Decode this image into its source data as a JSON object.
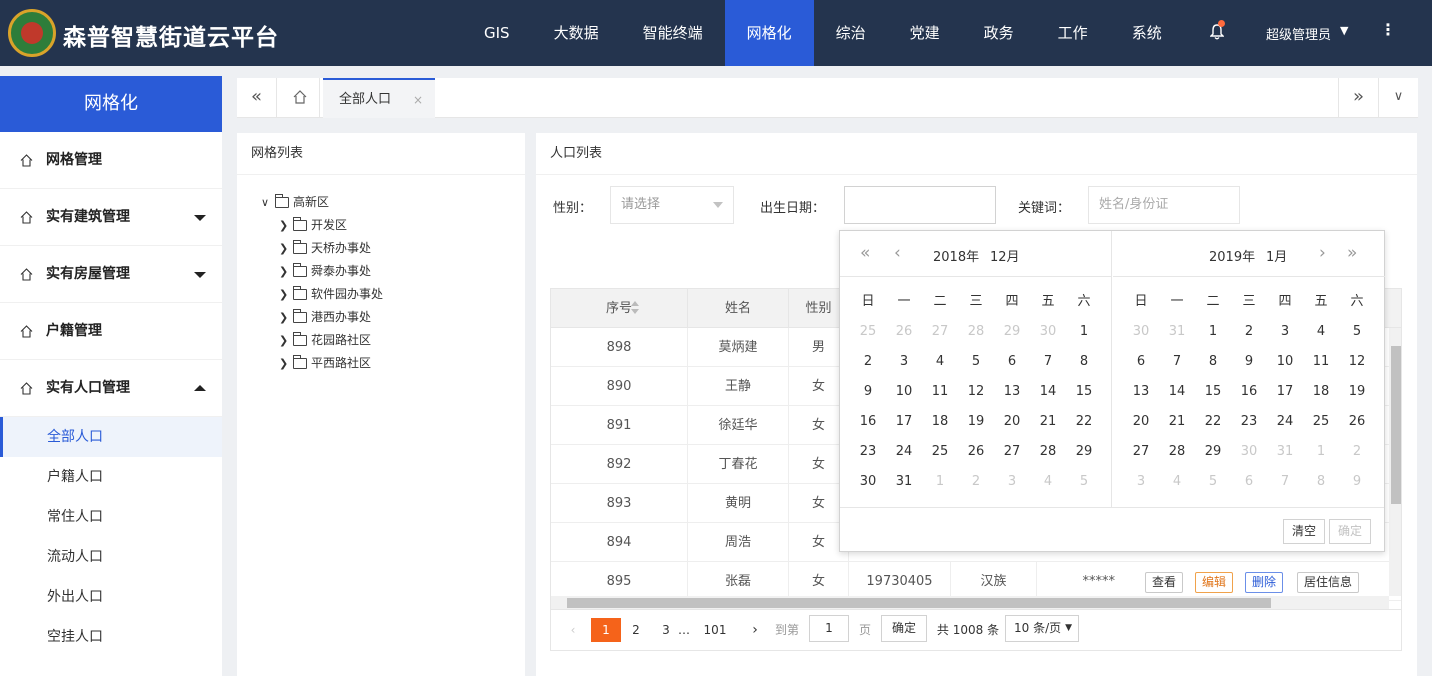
{
  "header": {
    "title": "森普智慧街道云平台",
    "nav": [
      "GIS",
      "大数据",
      "智能终端",
      "网格化",
      "综治",
      "党建",
      "政务",
      "工作",
      "系统"
    ],
    "active_nav": "网格化",
    "user": "超级管理员"
  },
  "sidebar": {
    "title": "网格化",
    "menus": [
      {
        "label": "网格管理"
      },
      {
        "label": "实有建筑管理"
      },
      {
        "label": "实有房屋管理"
      },
      {
        "label": "户籍管理"
      },
      {
        "label": "实有人口管理"
      }
    ],
    "subitems": [
      "全部人口",
      "户籍人口",
      "常住人口",
      "流动人口",
      "外出人口",
      "空挂人口"
    ]
  },
  "tabs": {
    "active": "全部人口",
    "close": "×"
  },
  "grid_panel": {
    "title": "网格列表",
    "root": "高新区",
    "children": [
      "开发区",
      "天桥办事处",
      "舜泰办事处",
      "软件园办事处",
      "港西办事处",
      "花园路社区",
      "平西路社区"
    ]
  },
  "main": {
    "title": "人口列表",
    "filters": {
      "gender_label": "性别：",
      "gender_placeholder": "请选择",
      "birth_label": "出生日期：",
      "keyword_label": "关键词：",
      "keyword_placeholder": "姓名/身份证"
    },
    "columns": [
      "序号",
      "姓名",
      "性别"
    ],
    "rows": [
      {
        "id": "898",
        "name": "莫炳建",
        "gender": "男"
      },
      {
        "id": "890",
        "name": "王静",
        "gender": "女"
      },
      {
        "id": "891",
        "name": "徐廷华",
        "gender": "女"
      },
      {
        "id": "892",
        "name": "丁春花",
        "gender": "女"
      },
      {
        "id": "893",
        "name": "黄明",
        "gender": "女"
      },
      {
        "id": "894",
        "name": "周浩",
        "gender": "女"
      },
      {
        "id": "895",
        "name": "张磊",
        "gender": "女",
        "birth": "19730405",
        "ethnic": "汉族",
        "idcard": "*****"
      }
    ],
    "ops": [
      "查看",
      "编辑",
      "删除",
      "居住信息"
    ]
  },
  "pagination": {
    "pages": [
      "1",
      "2",
      "3",
      "…",
      "101"
    ],
    "goto_label": "到第",
    "goto_value": "1",
    "page_unit": "页",
    "ok": "确定",
    "total": "共 1008 条",
    "page_size": "10 条/页"
  },
  "datepicker": {
    "left_year": "2018年",
    "left_month": "12月",
    "right_year": "2019年",
    "right_month": "1月",
    "weekdays": [
      "日",
      "一",
      "二",
      "三",
      "四",
      "五",
      "六"
    ],
    "left_days": [
      "25",
      "26",
      "27",
      "28",
      "29",
      "30",
      "1",
      "2",
      "3",
      "4",
      "5",
      "6",
      "7",
      "8",
      "9",
      "10",
      "11",
      "12",
      "13",
      "14",
      "15",
      "16",
      "17",
      "18",
      "19",
      "20",
      "21",
      "22",
      "23",
      "24",
      "25",
      "26",
      "27",
      "28",
      "29",
      "30",
      "31",
      "1",
      "2",
      "3",
      "4",
      "5"
    ],
    "left_mute_head": 6,
    "left_mute_tail": 5,
    "right_days": [
      "30",
      "31",
      "1",
      "2",
      "3",
      "4",
      "5",
      "6",
      "7",
      "8",
      "9",
      "10",
      "11",
      "12",
      "13",
      "14",
      "15",
      "16",
      "17",
      "18",
      "19",
      "20",
      "21",
      "22",
      "23",
      "24",
      "25",
      "26",
      "27",
      "28",
      "29",
      "30",
      "31",
      "1",
      "2",
      "3",
      "4",
      "5",
      "6",
      "7",
      "8",
      "9"
    ],
    "right_mute_head": 2,
    "right_mute_tail": 11,
    "clear": "清空",
    "confirm": "确定"
  }
}
